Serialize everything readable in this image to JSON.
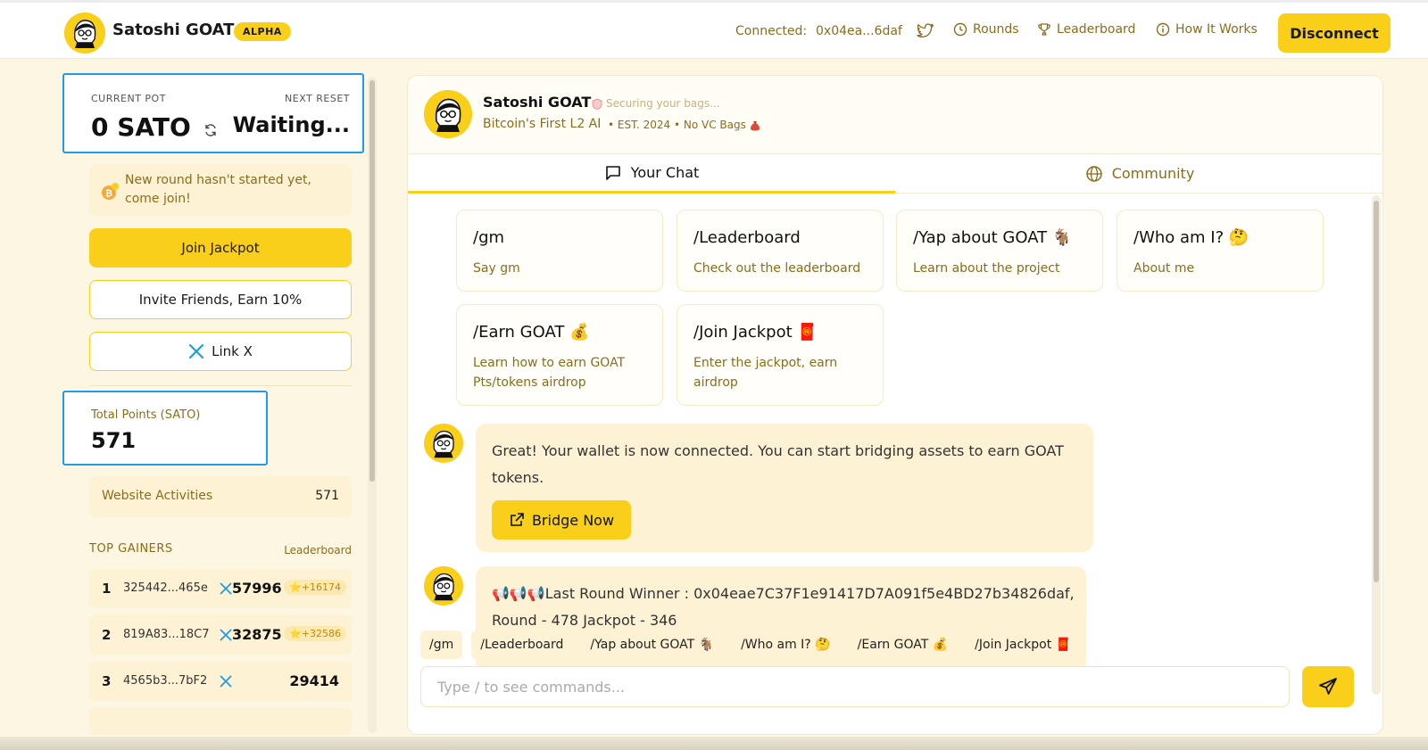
{
  "header": {
    "brand": "Satoshi GOAT",
    "badge": "ALPHA",
    "connected_label": "Connected:",
    "connected_address": "0x04ea...6daf",
    "nav": {
      "rounds": "Rounds",
      "leaderboard": "Leaderboard",
      "how_it_works": "How It Works"
    },
    "disconnect": "Disconnect"
  },
  "pot": {
    "current_label": "CURRENT POT",
    "current_value": "0 SATO",
    "reset_label": "NEXT RESET",
    "reset_value": "Waiting..."
  },
  "notice": "New round hasn't started yet, come join!",
  "buttons": {
    "join": "Join Jackpot",
    "invite": "Invite Friends, Earn 10%",
    "link_x": "Link X"
  },
  "points": {
    "label": "Total Points (SATO)",
    "value": "571"
  },
  "activities": {
    "label": "Website Activities",
    "value": "571"
  },
  "gainers": {
    "title": "TOP GAINERS",
    "link": "Leaderboard",
    "rows": [
      {
        "rank": "1",
        "address": "325442...465e",
        "score": "57996",
        "delta": "+16174"
      },
      {
        "rank": "2",
        "address": "819A83...18C7",
        "score": "32875",
        "delta": "+32586"
      },
      {
        "rank": "3",
        "address": "4565b3...7bF2",
        "score": "29414",
        "delta": ""
      }
    ]
  },
  "bot": {
    "name": "Satoshi GOAT",
    "status": "Securing your bags...",
    "tagline": "Bitcoin's First L2 AI",
    "meta": "• EST. 2024 • No VC Bags"
  },
  "tabs": {
    "chat": "Your Chat",
    "community": "Community"
  },
  "commands": [
    {
      "title": "/gm",
      "desc": "Say gm"
    },
    {
      "title": "/Leaderboard",
      "desc": "Check out the leaderboard"
    },
    {
      "title": "/Yap about GOAT 🐐",
      "desc": "Learn about the project"
    },
    {
      "title": "/Who am I? 🤔",
      "desc": "About me"
    },
    {
      "title": "/Earn GOAT 💰",
      "desc": "Learn how to earn GOAT Pts/tokens airdrop"
    },
    {
      "title": "/Join Jackpot 🧧",
      "desc": "Enter the jackpot, earn airdrop"
    }
  ],
  "messages": {
    "wallet": "Great! Your wallet is now connected. You can start bridging assets to earn GOAT tokens.",
    "bridge_btn": "Bridge Now",
    "winner_line1": "📢📢📢Last Round Winner : 0x04eae7C37F1e91417D7A091f5e4BD27b34826daf,",
    "winner_line2": "Round - 478 Jackpot - 346"
  },
  "quick": [
    "/gm",
    "/Leaderboard",
    "/Yap about GOAT 🐐",
    "/Who am I? 🤔",
    "/Earn GOAT 💰",
    "/Join Jackpot 🧧"
  ],
  "input": {
    "placeholder": "Type / to see commands..."
  },
  "colors": {
    "accent": "#f9cf1a",
    "text_muted": "#8a6d1c",
    "highlight_border": "#1e9be9",
    "background": "#fdf6e3"
  }
}
